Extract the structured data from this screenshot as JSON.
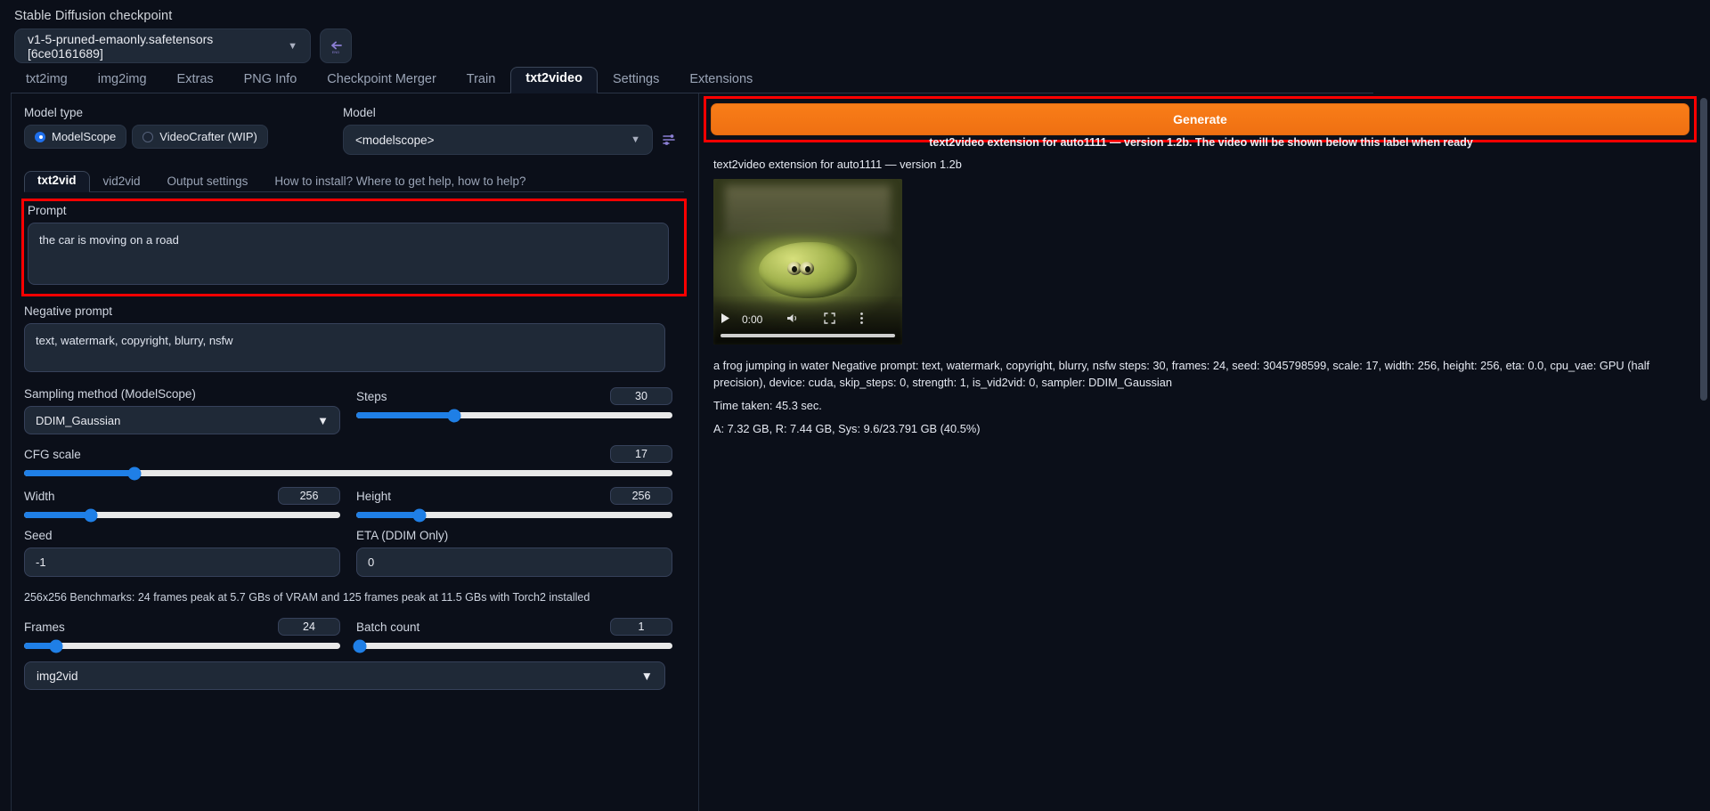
{
  "checkpoint": {
    "label": "Stable Diffusion checkpoint",
    "value": "v1-5-pruned-emaonly.safetensors [6ce0161689]",
    "caret": "▼",
    "refresh_icon": "refresh-arrow-icon"
  },
  "main_tabs": [
    {
      "label": "txt2img",
      "active": false
    },
    {
      "label": "img2img",
      "active": false
    },
    {
      "label": "Extras",
      "active": false
    },
    {
      "label": "PNG Info",
      "active": false
    },
    {
      "label": "Checkpoint Merger",
      "active": false
    },
    {
      "label": "Train",
      "active": false
    },
    {
      "label": "txt2video",
      "active": true
    },
    {
      "label": "Settings",
      "active": false
    },
    {
      "label": "Extensions",
      "active": false
    }
  ],
  "model_type": {
    "label": "Model type",
    "options": [
      {
        "label": "ModelScope",
        "selected": true
      },
      {
        "label": "VideoCrafter (WIP)",
        "selected": false
      }
    ]
  },
  "model": {
    "label": "Model",
    "value": "<modelscope>",
    "caret": "▼"
  },
  "sub_tabs": [
    {
      "label": "txt2vid",
      "active": true
    },
    {
      "label": "vid2vid",
      "active": false
    },
    {
      "label": "Output settings",
      "active": false
    },
    {
      "label": "How to install? Where to get help, how to help?",
      "active": false
    }
  ],
  "prompt": {
    "label": "Prompt",
    "value": "the car is moving on a road",
    "highlighted": true
  },
  "negative_prompt": {
    "label": "Negative prompt",
    "value": "text, watermark, copyright, blurry, nsfw"
  },
  "sampling_method": {
    "label": "Sampling method (ModelScope)",
    "value": "DDIM_Gaussian",
    "caret": "▼"
  },
  "steps": {
    "label": "Steps",
    "value": "30",
    "percent": 31
  },
  "cfg_scale": {
    "label": "CFG scale",
    "value": "17",
    "percent": 17
  },
  "width": {
    "label": "Width",
    "value": "256",
    "percent": 21
  },
  "height": {
    "label": "Height",
    "value": "256",
    "percent": 20
  },
  "seed": {
    "label": "Seed",
    "value": "-1"
  },
  "eta": {
    "label": "ETA (DDIM Only)",
    "value": "0"
  },
  "benchmark_note": "256x256 Benchmarks: 24 frames peak at 5.7 GBs of VRAM and 125 frames peak at 11.5 GBs with Torch2 installed",
  "frames": {
    "label": "Frames",
    "value": "24",
    "percent": 10
  },
  "batch_count": {
    "label": "Batch count",
    "value": "1",
    "percent": 1
  },
  "accordion": {
    "label": "img2vid",
    "caret": "▼"
  },
  "generate": {
    "label": "Generate",
    "highlighted": true,
    "color": "#f97d18"
  },
  "status_overlay": "text2video extension for auto1111 — version 1.2b. The video will be shown below this label when ready",
  "version_line": "text2video extension for auto1111 — version 1.2b",
  "video": {
    "play_icon": "play-icon",
    "time": "0:00",
    "volume_icon": "volume-icon",
    "fullscreen_icon": "fullscreen-icon",
    "more_icon": "more-options-icon"
  },
  "output": {
    "params": "a frog jumping in water Negative prompt: text, watermark, copyright, blurry, nsfw steps: 30, frames: 24, seed: 3045798599, scale: 17, width: 256, height: 256, eta: 0.0, cpu_vae: GPU (half precision), device: cuda, skip_steps: 0, strength: 1, is_vid2vid: 0, sampler: DDIM_Gaussian",
    "time_taken": "Time taken: 45.3 sec.",
    "memory": "A: 7.32 GB, R: 7.44 GB, Sys: 9.6/23.791 GB (40.5%)"
  }
}
